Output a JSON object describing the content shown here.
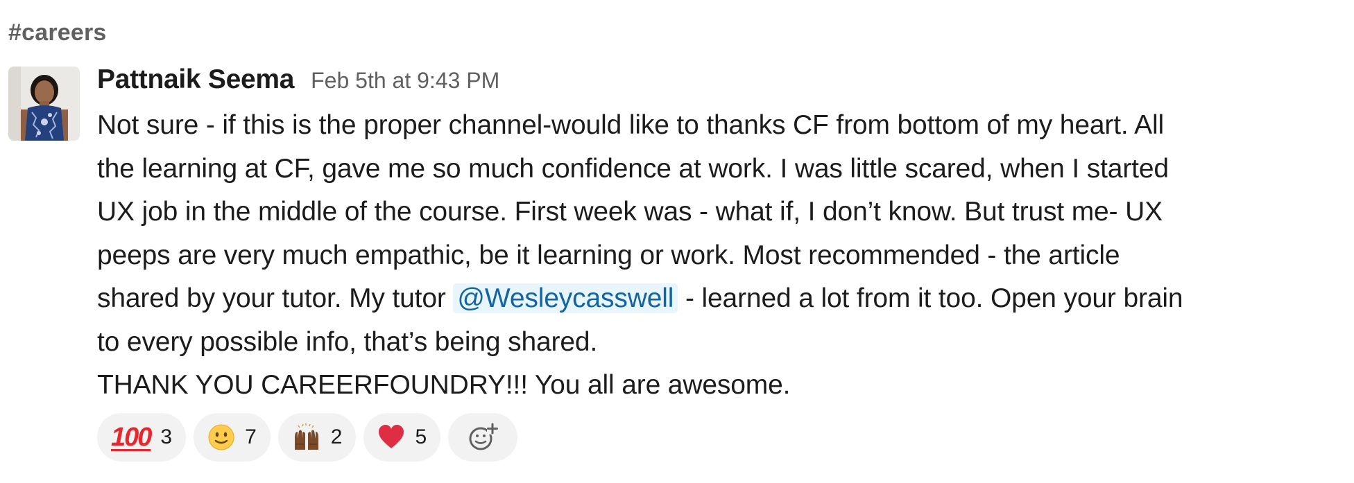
{
  "channel": {
    "name": "#careers"
  },
  "message": {
    "author": "Pattnaik Seema",
    "timestamp": "Feb 5th at 9:43 PM",
    "lines": [
      "Not sure - if this is the proper channel-would like to thanks CF from bottom of my heart. All",
      "the learning at CF, gave me so much confidence at work. I was little scared, when I started",
      "UX job in the middle of the course. First week was - what if, I don’t know. But trust me- UX",
      "peeps are very much empathic, be it learning or work.  Most recommended - the article"
    ],
    "line5_before": "shared by your tutor. My tutor ",
    "mention": "@Wesleycasswell",
    "line5_after": " - learned a lot from it too. Open your brain",
    "line6": "to every possible info, that’s being shared.",
    "line7": "THANK YOU CAREERFOUNDRY!!! You all are awesome."
  },
  "reactions": [
    {
      "icon": "hundred-points-icon",
      "emoji": "100",
      "count": "3"
    },
    {
      "icon": "slightly-smiling-face-icon",
      "emoji": "🙂",
      "count": "7"
    },
    {
      "icon": "raising-hands-icon",
      "emoji": "🙌🏾",
      "count": "2"
    },
    {
      "icon": "red-heart-icon",
      "emoji": "❤️",
      "count": "5"
    }
  ],
  "add_reaction": {
    "icon": "add-reaction-icon"
  }
}
